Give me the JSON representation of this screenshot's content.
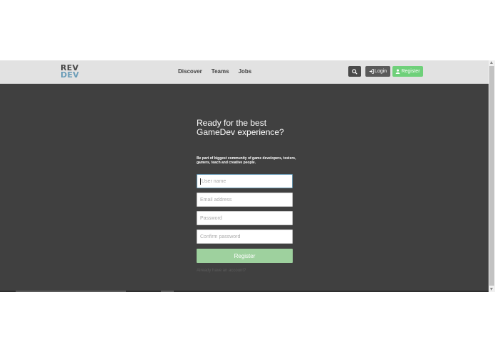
{
  "brand": {
    "line1": "REV",
    "line2": "DEV"
  },
  "nav": {
    "links": [
      "Discover",
      "Teams",
      "Jobs"
    ]
  },
  "header_actions": {
    "search_icon": "search-icon",
    "login_label": "Login",
    "register_label": "Register"
  },
  "hero": {
    "title_line1": "Ready for the best",
    "title_line2": "GameDev experience?",
    "subtitle": "Be part of biggest community of game developers, testers, gamers, teach and creative people."
  },
  "form": {
    "username_placeholder": "User name",
    "email_placeholder": "Email address",
    "password_placeholder": "Password",
    "confirm_placeholder": "Confirm password",
    "submit_label": "Register",
    "login_prompt": "Already have an account?"
  },
  "colors": {
    "navbar": "#e2e2e2",
    "background": "#404040",
    "accent_green": "#6fd07a",
    "button_green_light": "#9ed19e",
    "logo_blue": "#6b9db8"
  }
}
